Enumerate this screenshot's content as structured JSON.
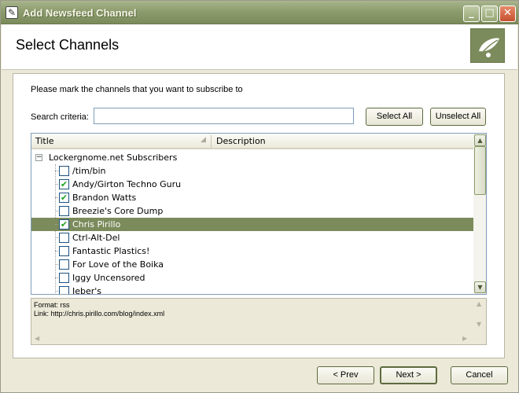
{
  "window": {
    "title": "Add Newsfeed Channel",
    "controls": {
      "minimize": "_",
      "maximize": "□",
      "close": "✕"
    }
  },
  "header": {
    "title": "Select Channels",
    "logo_icon": "leaf-logo-icon"
  },
  "instruction": "Please mark the channels that you want to subscribe to",
  "search": {
    "label": "Search criteria:",
    "value": "",
    "placeholder": ""
  },
  "buttons": {
    "select_all": "Select All",
    "unselect_all": "Unselect All",
    "prev": "< Prev",
    "next": "Next >",
    "cancel": "Cancel"
  },
  "list": {
    "columns": [
      "Title",
      "Description"
    ],
    "group": {
      "label": "Lockergnome.net Subscribers",
      "expanded": true,
      "toggle": "−"
    },
    "items": [
      {
        "label": "/tim/bin",
        "checked": false,
        "selected": false
      },
      {
        "label": "Andy/Girton Techno Guru",
        "checked": true,
        "selected": false
      },
      {
        "label": "Brandon Watts",
        "checked": true,
        "selected": false
      },
      {
        "label": "Breezie's Core Dump",
        "checked": false,
        "selected": false
      },
      {
        "label": "Chris Pirillo",
        "checked": true,
        "selected": true
      },
      {
        "label": "Ctrl-Alt-Del",
        "checked": false,
        "selected": false
      },
      {
        "label": "Fantastic Plastics!",
        "checked": false,
        "selected": false
      },
      {
        "label": "For Love of the Boika",
        "checked": false,
        "selected": false
      },
      {
        "label": "Iggy Uncensored",
        "checked": false,
        "selected": false
      },
      {
        "label": "Jeber's",
        "checked": false,
        "selected": false
      }
    ]
  },
  "details": {
    "format": "Format: rss",
    "link": "Link: http://chris.pirillo.com/blog/index.xml"
  },
  "colors": {
    "accent": "#7c8b5c",
    "selected_row": "#7c8b5c"
  }
}
